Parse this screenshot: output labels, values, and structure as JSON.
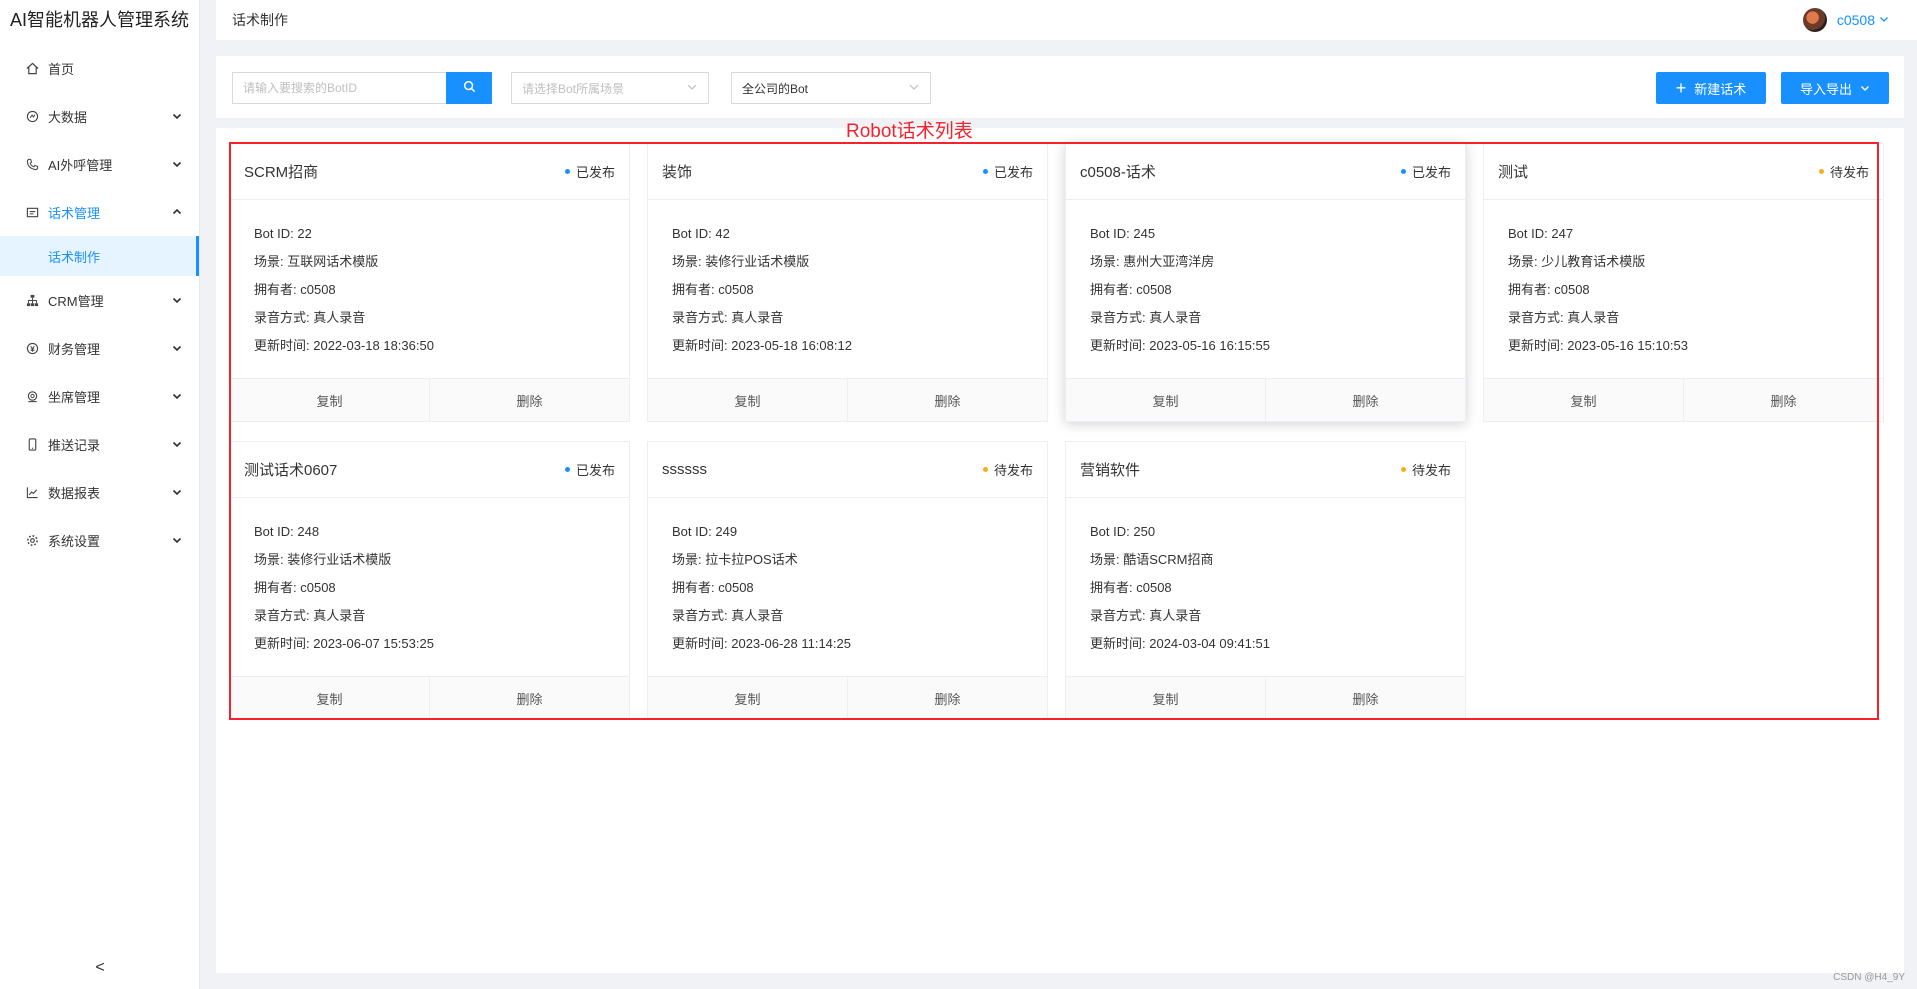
{
  "app": {
    "title": "AI智能机器人管理系统"
  },
  "sidebar": {
    "items": [
      {
        "label": "首页",
        "icon": "home-icon",
        "arrow": ""
      },
      {
        "label": "大数据",
        "icon": "data-icon",
        "arrow": "down"
      },
      {
        "label": "AI外呼管理",
        "icon": "phone-icon",
        "arrow": "down"
      },
      {
        "label": "话术管理",
        "icon": "script-icon",
        "arrow": "up"
      },
      {
        "label": "CRM管理",
        "icon": "org-icon",
        "arrow": "down"
      },
      {
        "label": "财务管理",
        "icon": "finance-icon",
        "arrow": "down"
      },
      {
        "label": "坐席管理",
        "icon": "agent-icon",
        "arrow": "down"
      },
      {
        "label": "推送记录",
        "icon": "mobile-icon",
        "arrow": "down"
      },
      {
        "label": "数据报表",
        "icon": "line-chart-icon",
        "arrow": "down"
      },
      {
        "label": "系统设置",
        "icon": "gear-icon",
        "arrow": "down"
      }
    ],
    "active_sub": "话术制作",
    "collapse": "<"
  },
  "header": {
    "page_title": "话术制作",
    "username": "c0508"
  },
  "toolbar": {
    "search_placeholder": "请输入要搜索的BotID",
    "scene_placeholder": "请选择Bot所属场景",
    "scope_value": "全公司的Bot",
    "new_button": "新建话术",
    "new_button_icon": "+",
    "import_button": "导入导出"
  },
  "annotation": {
    "label": "Robot话术列表"
  },
  "labels": {
    "bot_id": "Bot ID: ",
    "scene": "场景: ",
    "owner": "拥有者: ",
    "record": "录音方式: ",
    "updated": "更新时间: ",
    "copy": "复制",
    "delete": "删除"
  },
  "colors": {
    "published": "#1890ff",
    "pending": "#faad14",
    "accent": "#1890ff",
    "annotation": "#f5222d"
  },
  "cards": [
    {
      "title": "SCRM招商",
      "status": "已发布",
      "status_type": "published",
      "bot_id": "22",
      "scene": "互联网话术模版",
      "owner": "c0508",
      "record": "真人录音",
      "updated": "2022-03-18 18:36:50"
    },
    {
      "title": "装饰",
      "status": "已发布",
      "status_type": "published",
      "bot_id": "42",
      "scene": "装修行业话术模版",
      "owner": "c0508",
      "record": "真人录音",
      "updated": "2023-05-18 16:08:12"
    },
    {
      "title": "c0508-话术",
      "status": "已发布",
      "status_type": "published",
      "bot_id": "245",
      "scene": "惠州大亚湾洋房",
      "owner": "c0508",
      "record": "真人录音",
      "updated": "2023-05-16 16:15:55"
    },
    {
      "title": "测试",
      "status": "待发布",
      "status_type": "pending",
      "bot_id": "247",
      "scene": "少儿教育话术模版",
      "owner": "c0508",
      "record": "真人录音",
      "updated": "2023-05-16 15:10:53"
    },
    {
      "title": "测试话术0607",
      "status": "已发布",
      "status_type": "published",
      "bot_id": "248",
      "scene": "装修行业话术模版",
      "owner": "c0508",
      "record": "真人录音",
      "updated": "2023-06-07 15:53:25"
    },
    {
      "title": "ssssss",
      "status": "待发布",
      "status_type": "pending",
      "bot_id": "249",
      "scene": "拉卡拉POS话术",
      "owner": "c0508",
      "record": "真人录音",
      "updated": "2023-06-28 11:14:25"
    },
    {
      "title": "营销软件",
      "status": "待发布",
      "status_type": "pending",
      "bot_id": "250",
      "scene": "酷语SCRM招商",
      "owner": "c0508",
      "record": "真人录音",
      "updated": "2024-03-04 09:41:51"
    }
  ],
  "watermark": "CSDN @H4_9Y"
}
